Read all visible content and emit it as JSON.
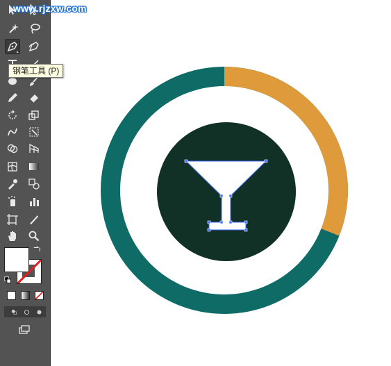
{
  "watermark": "www.rjzxw.com",
  "tooltip": "钢笔工具 (P)",
  "tools": [
    "selection-tool",
    "direct-selection-tool",
    "magic-wand-tool",
    "lasso-tool",
    "pen-tool",
    "curvature-tool",
    "type-tool",
    "line-segment-tool",
    "rectangle-tool",
    "paintbrush-tool",
    "pencil-tool",
    "eraser-tool",
    "rotate-tool",
    "scale-tool",
    "warp-tool",
    "free-transform-tool",
    "shape-builder-tool",
    "perspective-grid-tool",
    "mesh-tool",
    "gradient-tool",
    "eyedropper-tool",
    "blend-tool",
    "symbol-sprayer-tool",
    "column-graph-tool",
    "artboard-tool",
    "slice-tool",
    "hand-tool",
    "zoom-tool"
  ],
  "active_tool": "pen-tool",
  "colors": {
    "toolbar_bg": "#535353",
    "ring_teal": "#0f6b66",
    "ring_orange": "#df9a3b",
    "inner_circle": "#123126",
    "glass_fill": "#ffffff",
    "anchor": "#3d6cff",
    "fill_swatch": "#ffffff",
    "stroke_swatch_none": "#e02020"
  },
  "ring": {
    "orange_fraction": 0.31
  }
}
